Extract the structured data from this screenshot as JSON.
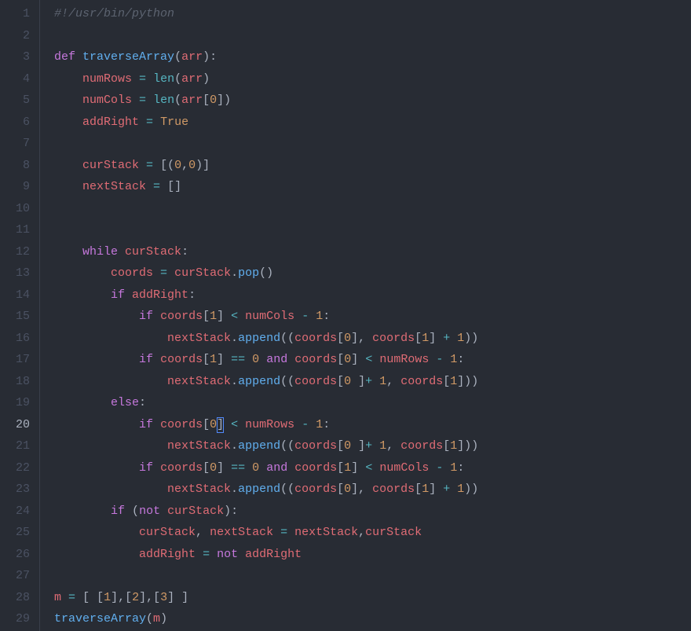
{
  "gutter": {
    "lines": [
      "1",
      "2",
      "3",
      "4",
      "5",
      "6",
      "7",
      "8",
      "9",
      "10",
      "11",
      "12",
      "13",
      "14",
      "15",
      "16",
      "17",
      "18",
      "19",
      "20",
      "21",
      "22",
      "23",
      "24",
      "25",
      "26",
      "27",
      "28",
      "29"
    ],
    "current": 20
  },
  "code": {
    "lines": [
      [
        {
          "c": "comment",
          "t": "#!/usr/bin/python"
        }
      ],
      [],
      [
        {
          "c": "def",
          "t": "def"
        },
        {
          "c": "text",
          "t": " "
        },
        {
          "c": "fn",
          "t": "traverseArray"
        },
        {
          "c": "punc",
          "t": "("
        },
        {
          "c": "var",
          "t": "arr"
        },
        {
          "c": "punc",
          "t": "):"
        }
      ],
      [
        {
          "c": "text",
          "t": "    "
        },
        {
          "c": "var",
          "t": "numRows"
        },
        {
          "c": "text",
          "t": " "
        },
        {
          "c": "op",
          "t": "="
        },
        {
          "c": "text",
          "t": " "
        },
        {
          "c": "builtin",
          "t": "len"
        },
        {
          "c": "punc",
          "t": "("
        },
        {
          "c": "var",
          "t": "arr"
        },
        {
          "c": "punc",
          "t": ")"
        }
      ],
      [
        {
          "c": "text",
          "t": "    "
        },
        {
          "c": "var",
          "t": "numCols"
        },
        {
          "c": "text",
          "t": " "
        },
        {
          "c": "op",
          "t": "="
        },
        {
          "c": "text",
          "t": " "
        },
        {
          "c": "builtin",
          "t": "len"
        },
        {
          "c": "punc",
          "t": "("
        },
        {
          "c": "var",
          "t": "arr"
        },
        {
          "c": "punc",
          "t": "["
        },
        {
          "c": "num",
          "t": "0"
        },
        {
          "c": "punc",
          "t": "])"
        }
      ],
      [
        {
          "c": "text",
          "t": "    "
        },
        {
          "c": "var",
          "t": "addRight"
        },
        {
          "c": "text",
          "t": " "
        },
        {
          "c": "op",
          "t": "="
        },
        {
          "c": "text",
          "t": " "
        },
        {
          "c": "bool",
          "t": "True"
        }
      ],
      [],
      [
        {
          "c": "text",
          "t": "    "
        },
        {
          "c": "var",
          "t": "curStack"
        },
        {
          "c": "text",
          "t": " "
        },
        {
          "c": "op",
          "t": "="
        },
        {
          "c": "text",
          "t": " "
        },
        {
          "c": "punc",
          "t": "[("
        },
        {
          "c": "num",
          "t": "0"
        },
        {
          "c": "punc",
          "t": ","
        },
        {
          "c": "num",
          "t": "0"
        },
        {
          "c": "punc",
          "t": ")]"
        }
      ],
      [
        {
          "c": "text",
          "t": "    "
        },
        {
          "c": "var",
          "t": "nextStack"
        },
        {
          "c": "text",
          "t": " "
        },
        {
          "c": "op",
          "t": "="
        },
        {
          "c": "text",
          "t": " "
        },
        {
          "c": "punc",
          "t": "[]"
        }
      ],
      [],
      [],
      [
        {
          "c": "text",
          "t": "    "
        },
        {
          "c": "kw",
          "t": "while"
        },
        {
          "c": "text",
          "t": " "
        },
        {
          "c": "var",
          "t": "curStack"
        },
        {
          "c": "punc",
          "t": ":"
        }
      ],
      [
        {
          "c": "text",
          "t": "        "
        },
        {
          "c": "var",
          "t": "coords"
        },
        {
          "c": "text",
          "t": " "
        },
        {
          "c": "op",
          "t": "="
        },
        {
          "c": "text",
          "t": " "
        },
        {
          "c": "var",
          "t": "curStack"
        },
        {
          "c": "punc",
          "t": "."
        },
        {
          "c": "fn",
          "t": "pop"
        },
        {
          "c": "punc",
          "t": "()"
        }
      ],
      [
        {
          "c": "text",
          "t": "        "
        },
        {
          "c": "kw",
          "t": "if"
        },
        {
          "c": "text",
          "t": " "
        },
        {
          "c": "var",
          "t": "addRight"
        },
        {
          "c": "punc",
          "t": ":"
        }
      ],
      [
        {
          "c": "text",
          "t": "            "
        },
        {
          "c": "kw",
          "t": "if"
        },
        {
          "c": "text",
          "t": " "
        },
        {
          "c": "var",
          "t": "coords"
        },
        {
          "c": "punc",
          "t": "["
        },
        {
          "c": "num",
          "t": "1"
        },
        {
          "c": "punc",
          "t": "]"
        },
        {
          "c": "text",
          "t": " "
        },
        {
          "c": "op",
          "t": "<"
        },
        {
          "c": "text",
          "t": " "
        },
        {
          "c": "var",
          "t": "numCols"
        },
        {
          "c": "text",
          "t": " "
        },
        {
          "c": "op",
          "t": "-"
        },
        {
          "c": "text",
          "t": " "
        },
        {
          "c": "num",
          "t": "1"
        },
        {
          "c": "punc",
          "t": ":"
        }
      ],
      [
        {
          "c": "text",
          "t": "                "
        },
        {
          "c": "var",
          "t": "nextStack"
        },
        {
          "c": "punc",
          "t": "."
        },
        {
          "c": "fn",
          "t": "append"
        },
        {
          "c": "punc",
          "t": "(("
        },
        {
          "c": "var",
          "t": "coords"
        },
        {
          "c": "punc",
          "t": "["
        },
        {
          "c": "num",
          "t": "0"
        },
        {
          "c": "punc",
          "t": "], "
        },
        {
          "c": "var",
          "t": "coords"
        },
        {
          "c": "punc",
          "t": "["
        },
        {
          "c": "num",
          "t": "1"
        },
        {
          "c": "punc",
          "t": "] "
        },
        {
          "c": "op",
          "t": "+"
        },
        {
          "c": "text",
          "t": " "
        },
        {
          "c": "num",
          "t": "1"
        },
        {
          "c": "punc",
          "t": "))"
        }
      ],
      [
        {
          "c": "text",
          "t": "            "
        },
        {
          "c": "kw",
          "t": "if"
        },
        {
          "c": "text",
          "t": " "
        },
        {
          "c": "var",
          "t": "coords"
        },
        {
          "c": "punc",
          "t": "["
        },
        {
          "c": "num",
          "t": "1"
        },
        {
          "c": "punc",
          "t": "]"
        },
        {
          "c": "text",
          "t": " "
        },
        {
          "c": "op",
          "t": "=="
        },
        {
          "c": "text",
          "t": " "
        },
        {
          "c": "num",
          "t": "0"
        },
        {
          "c": "text",
          "t": " "
        },
        {
          "c": "kw",
          "t": "and"
        },
        {
          "c": "text",
          "t": " "
        },
        {
          "c": "var",
          "t": "coords"
        },
        {
          "c": "punc",
          "t": "["
        },
        {
          "c": "num",
          "t": "0"
        },
        {
          "c": "punc",
          "t": "]"
        },
        {
          "c": "text",
          "t": " "
        },
        {
          "c": "op",
          "t": "<"
        },
        {
          "c": "text",
          "t": " "
        },
        {
          "c": "var",
          "t": "numRows"
        },
        {
          "c": "text",
          "t": " "
        },
        {
          "c": "op",
          "t": "-"
        },
        {
          "c": "text",
          "t": " "
        },
        {
          "c": "num",
          "t": "1"
        },
        {
          "c": "punc",
          "t": ":"
        }
      ],
      [
        {
          "c": "text",
          "t": "                "
        },
        {
          "c": "var",
          "t": "nextStack"
        },
        {
          "c": "punc",
          "t": "."
        },
        {
          "c": "fn",
          "t": "append"
        },
        {
          "c": "punc",
          "t": "(("
        },
        {
          "c": "var",
          "t": "coords"
        },
        {
          "c": "punc",
          "t": "["
        },
        {
          "c": "num",
          "t": "0"
        },
        {
          "c": "text",
          "t": " "
        },
        {
          "c": "punc",
          "t": "]"
        },
        {
          "c": "op",
          "t": "+"
        },
        {
          "c": "text",
          "t": " "
        },
        {
          "c": "num",
          "t": "1"
        },
        {
          "c": "punc",
          "t": ", "
        },
        {
          "c": "var",
          "t": "coords"
        },
        {
          "c": "punc",
          "t": "["
        },
        {
          "c": "num",
          "t": "1"
        },
        {
          "c": "punc",
          "t": "]))"
        }
      ],
      [
        {
          "c": "text",
          "t": "        "
        },
        {
          "c": "kw",
          "t": "else"
        },
        {
          "c": "punc",
          "t": ":"
        }
      ],
      [
        {
          "c": "text",
          "t": "            "
        },
        {
          "c": "kw",
          "t": "if"
        },
        {
          "c": "text",
          "t": " "
        },
        {
          "c": "var",
          "t": "coords"
        },
        {
          "c": "punc",
          "t": "["
        },
        {
          "c": "num",
          "t": "0"
        },
        {
          "c": "punc",
          "t": "]"
        },
        {
          "c": "text",
          "t": " "
        },
        {
          "c": "op",
          "t": "<"
        },
        {
          "c": "text",
          "t": " "
        },
        {
          "c": "var",
          "t": "numRows"
        },
        {
          "c": "text",
          "t": " "
        },
        {
          "c": "op",
          "t": "-"
        },
        {
          "c": "text",
          "t": " "
        },
        {
          "c": "num",
          "t": "1"
        },
        {
          "c": "punc",
          "t": ":"
        }
      ],
      [
        {
          "c": "text",
          "t": "                "
        },
        {
          "c": "var",
          "t": "nextStack"
        },
        {
          "c": "punc",
          "t": "."
        },
        {
          "c": "fn",
          "t": "append"
        },
        {
          "c": "punc",
          "t": "(("
        },
        {
          "c": "var",
          "t": "coords"
        },
        {
          "c": "punc",
          "t": "["
        },
        {
          "c": "num",
          "t": "0"
        },
        {
          "c": "text",
          "t": " "
        },
        {
          "c": "punc",
          "t": "]"
        },
        {
          "c": "op",
          "t": "+"
        },
        {
          "c": "text",
          "t": " "
        },
        {
          "c": "num",
          "t": "1"
        },
        {
          "c": "punc",
          "t": ", "
        },
        {
          "c": "var",
          "t": "coords"
        },
        {
          "c": "punc",
          "t": "["
        },
        {
          "c": "num",
          "t": "1"
        },
        {
          "c": "punc",
          "t": "]))"
        }
      ],
      [
        {
          "c": "text",
          "t": "            "
        },
        {
          "c": "kw",
          "t": "if"
        },
        {
          "c": "text",
          "t": " "
        },
        {
          "c": "var",
          "t": "coords"
        },
        {
          "c": "punc",
          "t": "["
        },
        {
          "c": "num",
          "t": "0"
        },
        {
          "c": "punc",
          "t": "]"
        },
        {
          "c": "text",
          "t": " "
        },
        {
          "c": "op",
          "t": "=="
        },
        {
          "c": "text",
          "t": " "
        },
        {
          "c": "num",
          "t": "0"
        },
        {
          "c": "text",
          "t": " "
        },
        {
          "c": "kw",
          "t": "and"
        },
        {
          "c": "text",
          "t": " "
        },
        {
          "c": "var",
          "t": "coords"
        },
        {
          "c": "punc",
          "t": "["
        },
        {
          "c": "num",
          "t": "1"
        },
        {
          "c": "punc",
          "t": "]"
        },
        {
          "c": "text",
          "t": " "
        },
        {
          "c": "op",
          "t": "<"
        },
        {
          "c": "text",
          "t": " "
        },
        {
          "c": "var",
          "t": "numCols"
        },
        {
          "c": "text",
          "t": " "
        },
        {
          "c": "op",
          "t": "-"
        },
        {
          "c": "text",
          "t": " "
        },
        {
          "c": "num",
          "t": "1"
        },
        {
          "c": "punc",
          "t": ":"
        }
      ],
      [
        {
          "c": "text",
          "t": "                "
        },
        {
          "c": "var",
          "t": "nextStack"
        },
        {
          "c": "punc",
          "t": "."
        },
        {
          "c": "fn",
          "t": "append"
        },
        {
          "c": "punc",
          "t": "(("
        },
        {
          "c": "var",
          "t": "coords"
        },
        {
          "c": "punc",
          "t": "["
        },
        {
          "c": "num",
          "t": "0"
        },
        {
          "c": "punc",
          "t": "], "
        },
        {
          "c": "var",
          "t": "coords"
        },
        {
          "c": "punc",
          "t": "["
        },
        {
          "c": "num",
          "t": "1"
        },
        {
          "c": "punc",
          "t": "] "
        },
        {
          "c": "op",
          "t": "+"
        },
        {
          "c": "text",
          "t": " "
        },
        {
          "c": "num",
          "t": "1"
        },
        {
          "c": "punc",
          "t": "))"
        }
      ],
      [
        {
          "c": "text",
          "t": "        "
        },
        {
          "c": "kw",
          "t": "if"
        },
        {
          "c": "text",
          "t": " "
        },
        {
          "c": "punc",
          "t": "("
        },
        {
          "c": "kw",
          "t": "not"
        },
        {
          "c": "text",
          "t": " "
        },
        {
          "c": "var",
          "t": "curStack"
        },
        {
          "c": "punc",
          "t": "):"
        }
      ],
      [
        {
          "c": "text",
          "t": "            "
        },
        {
          "c": "var",
          "t": "curStack"
        },
        {
          "c": "punc",
          "t": ", "
        },
        {
          "c": "var",
          "t": "nextStack"
        },
        {
          "c": "text",
          "t": " "
        },
        {
          "c": "op",
          "t": "="
        },
        {
          "c": "text",
          "t": " "
        },
        {
          "c": "var",
          "t": "nextStack"
        },
        {
          "c": "punc",
          "t": ","
        },
        {
          "c": "var",
          "t": "curStack"
        }
      ],
      [
        {
          "c": "text",
          "t": "            "
        },
        {
          "c": "var",
          "t": "addRight"
        },
        {
          "c": "text",
          "t": " "
        },
        {
          "c": "op",
          "t": "="
        },
        {
          "c": "text",
          "t": " "
        },
        {
          "c": "kw",
          "t": "not"
        },
        {
          "c": "text",
          "t": " "
        },
        {
          "c": "var",
          "t": "addRight"
        }
      ],
      [],
      [
        {
          "c": "var",
          "t": "m"
        },
        {
          "c": "text",
          "t": " "
        },
        {
          "c": "op",
          "t": "="
        },
        {
          "c": "text",
          "t": " "
        },
        {
          "c": "punc",
          "t": "[ ["
        },
        {
          "c": "num",
          "t": "1"
        },
        {
          "c": "punc",
          "t": "],["
        },
        {
          "c": "num",
          "t": "2"
        },
        {
          "c": "punc",
          "t": "],["
        },
        {
          "c": "num",
          "t": "3"
        },
        {
          "c": "punc",
          "t": "] ]"
        }
      ],
      [
        {
          "c": "fn",
          "t": "traverseArray"
        },
        {
          "c": "punc",
          "t": "("
        },
        {
          "c": "var",
          "t": "m"
        },
        {
          "c": "punc",
          "t": ")"
        }
      ]
    ]
  },
  "cursor": {
    "line": 20,
    "col": 23
  }
}
